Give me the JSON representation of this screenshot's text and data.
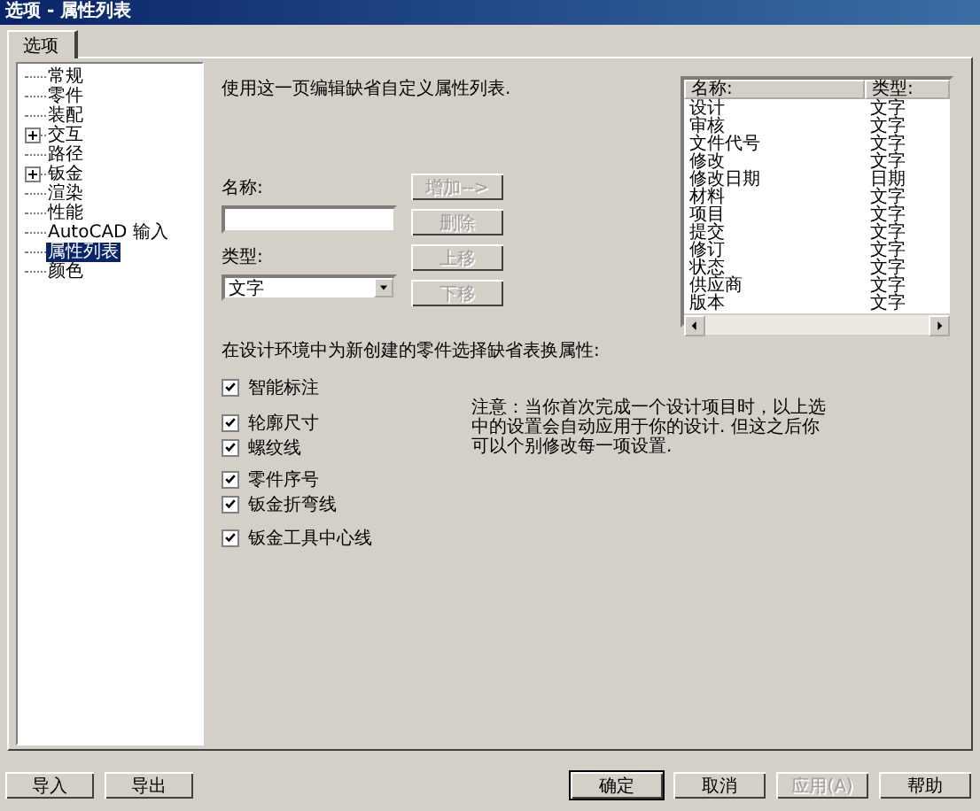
{
  "window": {
    "title": "选项 - 属性列表"
  },
  "tabs": [
    {
      "label": "选项",
      "selected": true
    }
  ],
  "sidebar": {
    "items": [
      {
        "label": "常规",
        "selected": false
      },
      {
        "label": "零件",
        "selected": false
      },
      {
        "label": "装配",
        "selected": false
      },
      {
        "label": "交互",
        "selected": false,
        "expanded": false
      },
      {
        "label": "路径",
        "selected": false
      },
      {
        "label": "钣金",
        "selected": false,
        "expanded": false
      },
      {
        "label": "渲染",
        "selected": false
      },
      {
        "label": "性能",
        "selected": false
      },
      {
        "label": "AutoCAD 输入",
        "selected": false
      },
      {
        "label": "属性列表",
        "selected": true
      },
      {
        "label": "颜色",
        "selected": false
      }
    ]
  },
  "description": "使用这一页编辑缺省自定义属性列表.",
  "name_field": {
    "label": "名称:"
  },
  "type_field": {
    "label": "类型:",
    "value": "文字"
  },
  "list_buttons": [
    {
      "label": "增加-->",
      "disabled": true
    },
    {
      "label": "删除",
      "disabled": true
    },
    {
      "label": "上移",
      "disabled": true
    },
    {
      "label": "下移",
      "disabled": true
    }
  ],
  "table": {
    "columns": [
      "名称:",
      "类型:"
    ],
    "rows": [
      [
        "设计",
        "文字"
      ],
      [
        "审核",
        "文字"
      ],
      [
        "文件代号",
        "文字"
      ],
      [
        "修改",
        "文字"
      ],
      [
        "修改日期",
        "日期"
      ],
      [
        "材料",
        "文字"
      ],
      [
        "项目",
        "文字"
      ],
      [
        "提交",
        "文字"
      ],
      [
        "修订",
        "文字"
      ],
      [
        "状态",
        "文字"
      ],
      [
        "供应商",
        "文字"
      ],
      [
        "版本",
        "文字"
      ]
    ]
  },
  "defaults_label": "在设计环境中为新创建的零件选择缺省表换属性:",
  "options": [
    {
      "label": "智能标注",
      "checked": true
    },
    {
      "label": "轮廓尺寸",
      "checked": true
    },
    {
      "label": "螺纹线",
      "checked": true
    },
    {
      "label": "零件序号",
      "checked": true
    },
    {
      "label": "钣金折弯线",
      "checked": true
    },
    {
      "label": "钣金工具中心线",
      "checked": true
    }
  ],
  "note": "注意：当你首次完成一个设计项目时，以上选中的设置会自动应用于你的设计. 但这之后你可以个别修改每一项设置.",
  "footer_left": [
    {
      "label": "导入",
      "disabled": false
    },
    {
      "label": "导出",
      "disabled": false
    }
  ],
  "footer_right": [
    {
      "label": "确定",
      "disabled": false,
      "default": true
    },
    {
      "label": "取消",
      "disabled": false,
      "default": false
    },
    {
      "label": "应用(A)",
      "disabled": true,
      "default": false
    },
    {
      "label": "帮助",
      "disabled": false,
      "default": false
    }
  ]
}
